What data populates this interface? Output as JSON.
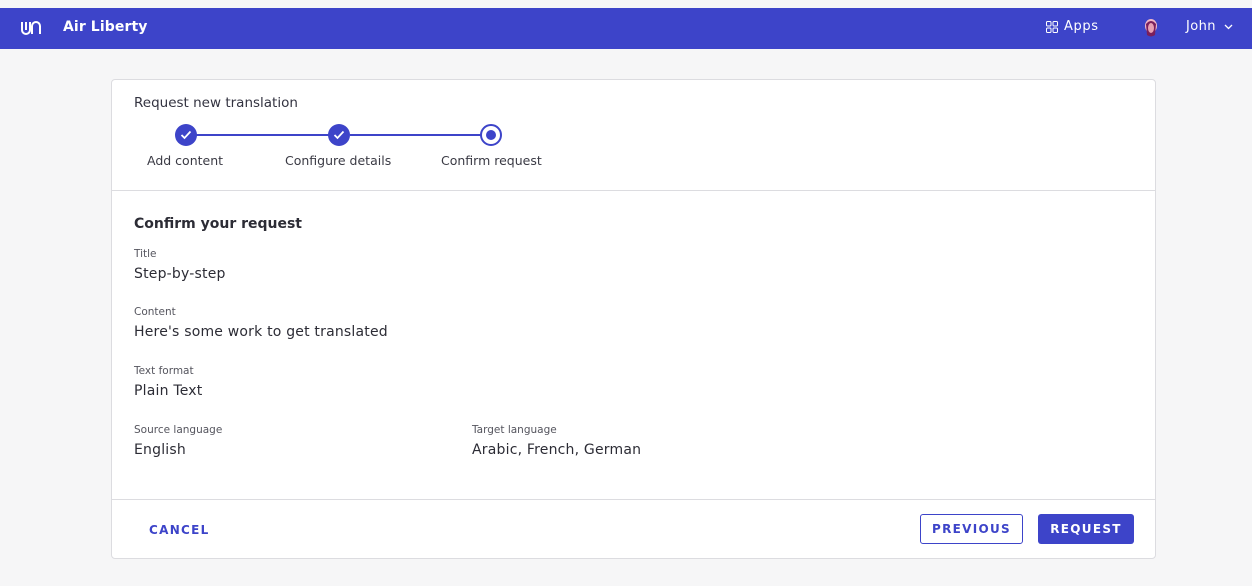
{
  "topbar": {
    "brand": "Air Liberty",
    "apps_label": "Apps",
    "user_name": "John",
    "color": "#3d44c9"
  },
  "card": {
    "title": "Request new translation",
    "steps": [
      {
        "label": "Add content",
        "status": "done"
      },
      {
        "label": "Configure details",
        "status": "done"
      },
      {
        "label": "Confirm request",
        "status": "current"
      }
    ],
    "section_heading": "Confirm your request",
    "fields": {
      "title": {
        "label": "Title",
        "value": "Step-by-step"
      },
      "content": {
        "label": "Content",
        "value": "Here's some work to get translated"
      },
      "text_format": {
        "label": "Text format",
        "value": "Plain Text"
      },
      "source_language": {
        "label": "Source language",
        "value": "English"
      },
      "target_language": {
        "label": "Target language",
        "value": "Arabic, French, German"
      }
    },
    "footer": {
      "cancel_label": "CANCEL",
      "previous_label": "PREVIOUS",
      "request_label": "REQUEST"
    }
  }
}
